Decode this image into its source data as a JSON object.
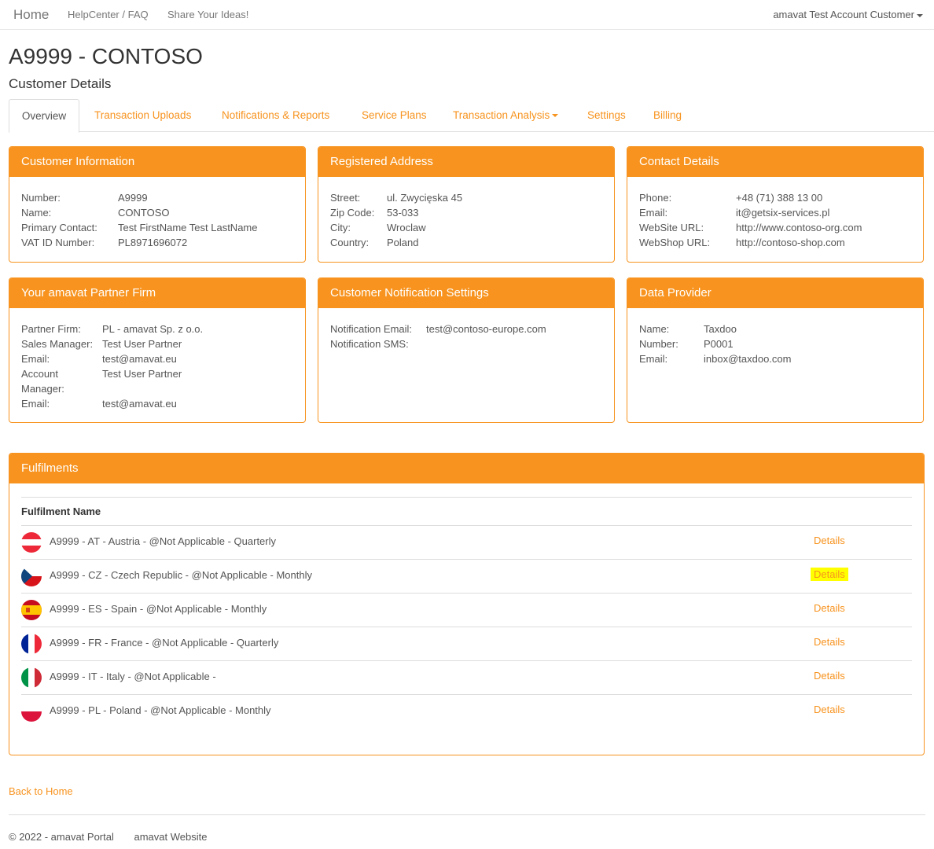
{
  "nav": {
    "home": "Home",
    "links": [
      "HelpCenter / FAQ",
      "Share Your Ideas!"
    ],
    "user": "amavat Test Account Customer"
  },
  "page": {
    "title": "A9999 - CONTOSO",
    "subtitle": "Customer Details"
  },
  "tabs": [
    "Overview",
    "Transaction Uploads",
    "Notifications & Reports",
    "Service Plans",
    "Transaction Analysis",
    "Settings",
    "Billing"
  ],
  "panels": {
    "customer_info": {
      "title": "Customer Information",
      "rows": [
        {
          "k": "Number:",
          "v": "A9999"
        },
        {
          "k": "Name:",
          "v": "CONTOSO"
        },
        {
          "k": "Primary Contact:",
          "v": "Test FirstName Test LastName"
        },
        {
          "k": "VAT ID Number:",
          "v": "PL8971696072"
        }
      ]
    },
    "registered_address": {
      "title": "Registered Address",
      "rows": [
        {
          "k": "Street:",
          "v": "ul. Zwycięska 45"
        },
        {
          "k": "Zip Code:",
          "v": "53-033"
        },
        {
          "k": "City:",
          "v": "Wroclaw"
        },
        {
          "k": "Country:",
          "v": "Poland"
        }
      ]
    },
    "contact_details": {
      "title": "Contact Details",
      "rows": [
        {
          "k": "Phone:",
          "v": "+48 (71) 388 13 00"
        },
        {
          "k": "Email:",
          "v": "it@getsix-services.pl"
        },
        {
          "k": "WebSite URL:",
          "v": "http://www.contoso-org.com"
        },
        {
          "k": "WebShop URL:",
          "v": "http://contoso-shop.com"
        }
      ]
    },
    "partner_firm": {
      "title": "Your amavat Partner Firm",
      "rows": [
        {
          "k": "Partner Firm:",
          "v": "PL - amavat Sp. z o.o."
        },
        {
          "k": "Sales Manager:",
          "v": "Test User Partner"
        },
        {
          "k": "Email:",
          "v": "test@amavat.eu"
        },
        {
          "k": "Account Manager:",
          "v": "Test User Partner"
        },
        {
          "k": "Email:",
          "v": "test@amavat.eu"
        }
      ]
    },
    "notification_settings": {
      "title": "Customer Notification Settings",
      "rows": [
        {
          "k": "Notification Email:",
          "v": "test@contoso-europe.com"
        },
        {
          "k": "Notification SMS:",
          "v": ""
        }
      ]
    },
    "data_provider": {
      "title": "Data Provider",
      "rows": [
        {
          "k": "Name:",
          "v": "Taxdoo"
        },
        {
          "k": "Number:",
          "v": "P0001"
        },
        {
          "k": "Email:",
          "v": "inbox@taxdoo.com"
        }
      ]
    }
  },
  "fulfilments": {
    "title": "Fulfilments",
    "column": "Fulfilment Name",
    "details_label": "Details",
    "rows": [
      {
        "name": "A9999 - AT - Austria  - @Not Applicable  - Quarterly",
        "flag": "austria-flag-icon"
      },
      {
        "name": "A9999 - CZ - Czech Republic  - @Not Applicable  - Monthly",
        "flag": "czech-flag-icon"
      },
      {
        "name": "A9999 - ES - Spain  - @Not Applicable  - Monthly",
        "flag": "spain-flag-icon"
      },
      {
        "name": "A9999 - FR - France  - @Not Applicable  - Quarterly",
        "flag": "france-flag-icon"
      },
      {
        "name": "A9999 - IT - Italy  - @Not Applicable  -",
        "flag": "italy-flag-icon"
      },
      {
        "name": "A9999 - PL - Poland  - @Not Applicable  - Monthly",
        "flag": "poland-flag-icon"
      }
    ]
  },
  "back_link": "Back to Home",
  "footer": {
    "copyright": "© 2022 - amavat Portal",
    "website": "amavat Website"
  },
  "colors": {
    "accent": "#f7931e",
    "highlight": "#ffff00"
  }
}
